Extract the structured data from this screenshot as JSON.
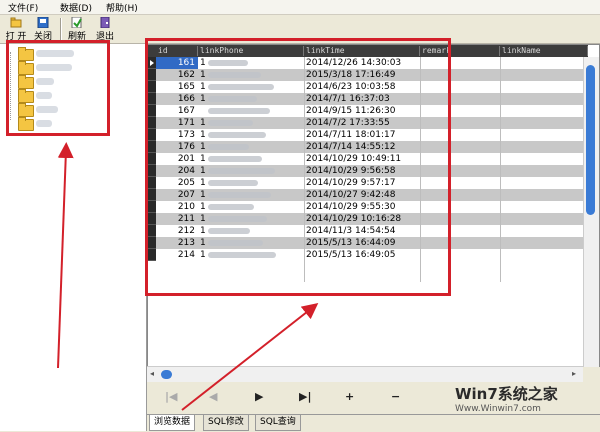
{
  "menu": [
    "文件(F)",
    "数据(D)",
    "帮助(H)"
  ],
  "toolbar": {
    "open": "打 开",
    "close": "关闭",
    "refresh": "刷新",
    "exit": "退出"
  },
  "grid": {
    "columns": [
      "id",
      "linkPhone",
      "linkTime",
      "remark",
      "linkName"
    ],
    "rows": [
      {
        "id": "161",
        "phone": "1",
        "time": "2014/12/26 14:30:03"
      },
      {
        "id": "162",
        "phone": "1",
        "time": "2015/3/18 17:16:49"
      },
      {
        "id": "165",
        "phone": "1",
        "time": "2014/6/23 10:03:58"
      },
      {
        "id": "166",
        "phone": "1",
        "time": "2014/7/1 16:37:03"
      },
      {
        "id": "167",
        "phone": "",
        "time": "2014/9/15 11:26:30"
      },
      {
        "id": "171",
        "phone": "1",
        "time": "2014/7/2 17:33:55"
      },
      {
        "id": "173",
        "phone": "1",
        "time": "2014/7/11 18:01:17"
      },
      {
        "id": "176",
        "phone": "1",
        "time": "2014/7/14 14:55:12"
      },
      {
        "id": "201",
        "phone": "1",
        "time": "2014/10/29 10:49:11"
      },
      {
        "id": "204",
        "phone": "1",
        "time": "2014/10/29 9:56:58"
      },
      {
        "id": "205",
        "phone": "1",
        "time": "2014/10/29 9:57:17"
      },
      {
        "id": "207",
        "phone": "1",
        "time": "2014/10/27 9:42:48"
      },
      {
        "id": "210",
        "phone": "1",
        "time": "2014/10/29 9:55:30"
      },
      {
        "id": "211",
        "phone": "1",
        "time": "2014/10/29 10:16:28"
      },
      {
        "id": "212",
        "phone": "1",
        "time": "2014/11/3 14:54:54"
      },
      {
        "id": "213",
        "phone": "1",
        "time": "2015/5/13 16:44:09"
      },
      {
        "id": "214",
        "phone": "1",
        "time": "2015/5/13 16:49:05"
      }
    ]
  },
  "nav": {
    "first": "|◀",
    "prev": "◀",
    "next": "▶",
    "last": "▶|",
    "add": "+",
    "delete": "−"
  },
  "tabs": [
    "浏览数据",
    "SQL修改",
    "SQL查询"
  ],
  "watermark": {
    "title": "Win7系统之家",
    "url": "Www.Winwin7.com"
  },
  "colors": {
    "highlight": "#d3202a",
    "selection": "#316ac5",
    "scroll": "#3a7bd5"
  }
}
